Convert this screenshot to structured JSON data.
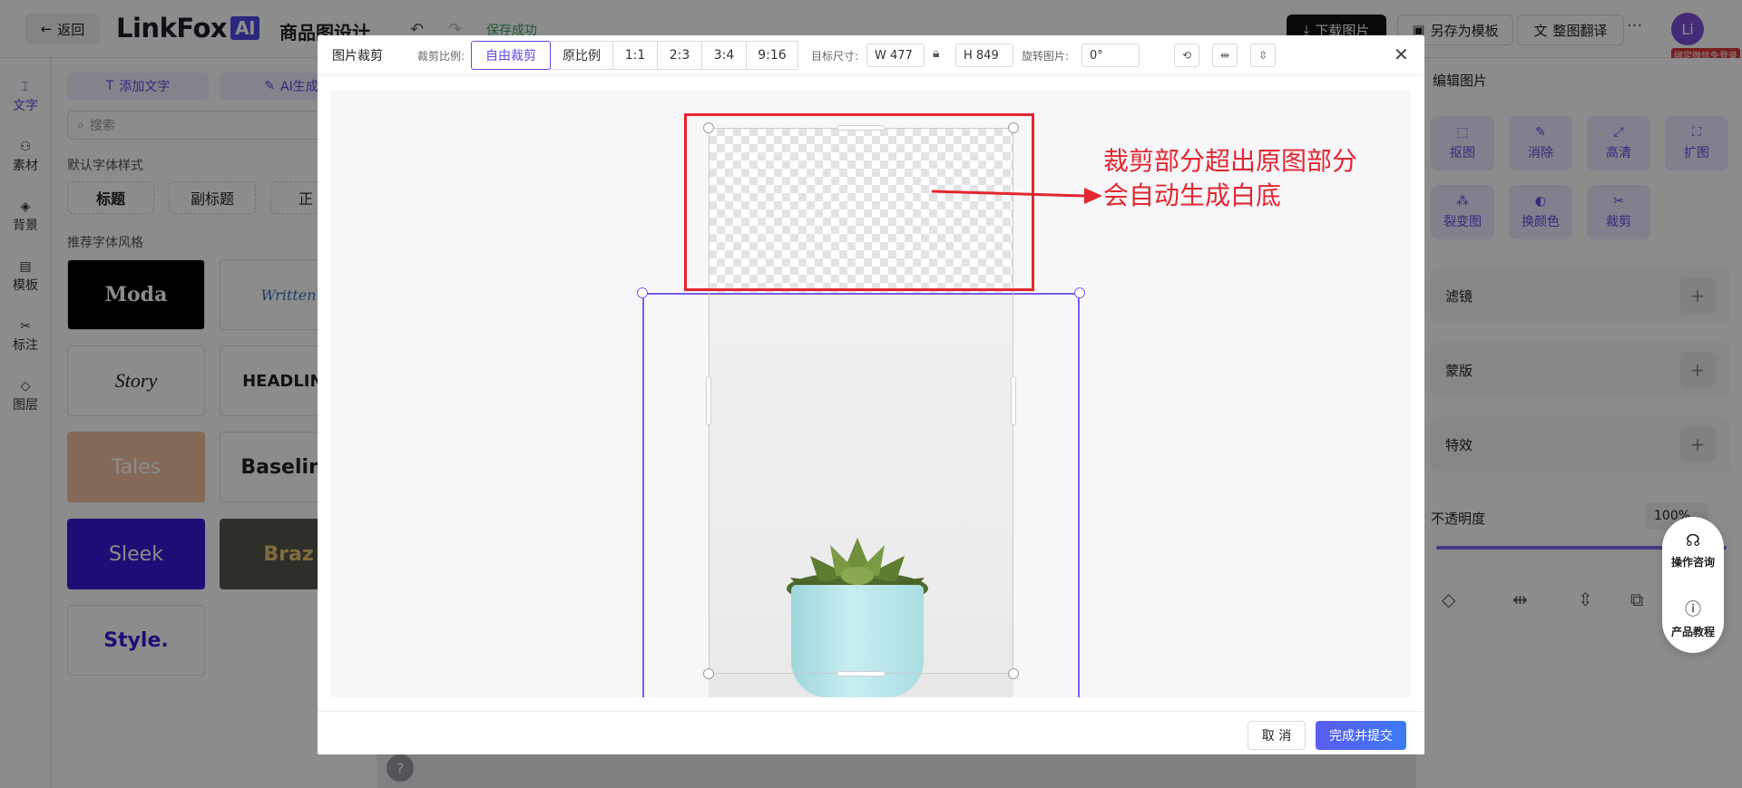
{
  "app": {
    "back_label": "返回",
    "logo_text": "LinkFox",
    "logo_ai": "AI",
    "page_title": "商品图设计",
    "save_status": "保存成功",
    "download_label": "下载图片",
    "save_template_label": "另存为模板",
    "translate_label": "整图翻译",
    "more_label": "···",
    "avatar_initial": "Li",
    "avatar_badge": "绑定微信免登录"
  },
  "left_rail": [
    {
      "label": "文字",
      "icon": "text-icon"
    },
    {
      "label": "素材",
      "icon": "material-icon"
    },
    {
      "label": "背景",
      "icon": "background-icon"
    },
    {
      "label": "模板",
      "icon": "template-icon"
    },
    {
      "label": "标注",
      "icon": "annotate-icon"
    },
    {
      "label": "图层",
      "icon": "layers-icon"
    }
  ],
  "left_panel": {
    "add_text": "添加文字",
    "ai_text": "AI生成文",
    "search_placeholder": "搜索",
    "default_styles_title": "默认字体样式",
    "chips": [
      "标题",
      "副标题",
      "正"
    ],
    "recommended_title": "推荐字体风格",
    "fonts": [
      "Moda",
      "Written",
      "Story",
      "HEADLINE",
      "Tales",
      "Baseline",
      "Sleek",
      "Braz",
      "Style."
    ]
  },
  "right_panel": {
    "title": "编辑图片",
    "tools": [
      "抠图",
      "消除",
      "高清",
      "扩图",
      "裂变图",
      "换颜色",
      "裁剪"
    ],
    "rows": [
      "滤镜",
      "蒙版",
      "特效"
    ],
    "opacity_label": "不透明度",
    "opacity_value": "100%",
    "opacity_fraction": 1.0
  },
  "float_help": {
    "consult": "操作咨询",
    "tutorial": "产品教程"
  },
  "modal": {
    "title": "图片裁剪",
    "ratio_label": "裁剪比例:",
    "ratios": [
      "自由裁剪",
      "原比例",
      "1:1",
      "2:3",
      "3:4",
      "9:16"
    ],
    "active_ratio": "自由裁剪",
    "target_size_label": "目标尺寸:",
    "width_value": "W 477",
    "height_value": "H 849",
    "rotate_label": "旋转图片:",
    "rotate_value": "0°",
    "annotation_line1": "裁剪部分超出原图部分",
    "annotation_line2": "会自动生成白底",
    "cancel_label": "取 消",
    "submit_label": "完成并提交"
  },
  "colors": {
    "accent": "#5b4ce6",
    "annotation_red": "#e3262f",
    "save_green": "#3aa45c"
  }
}
